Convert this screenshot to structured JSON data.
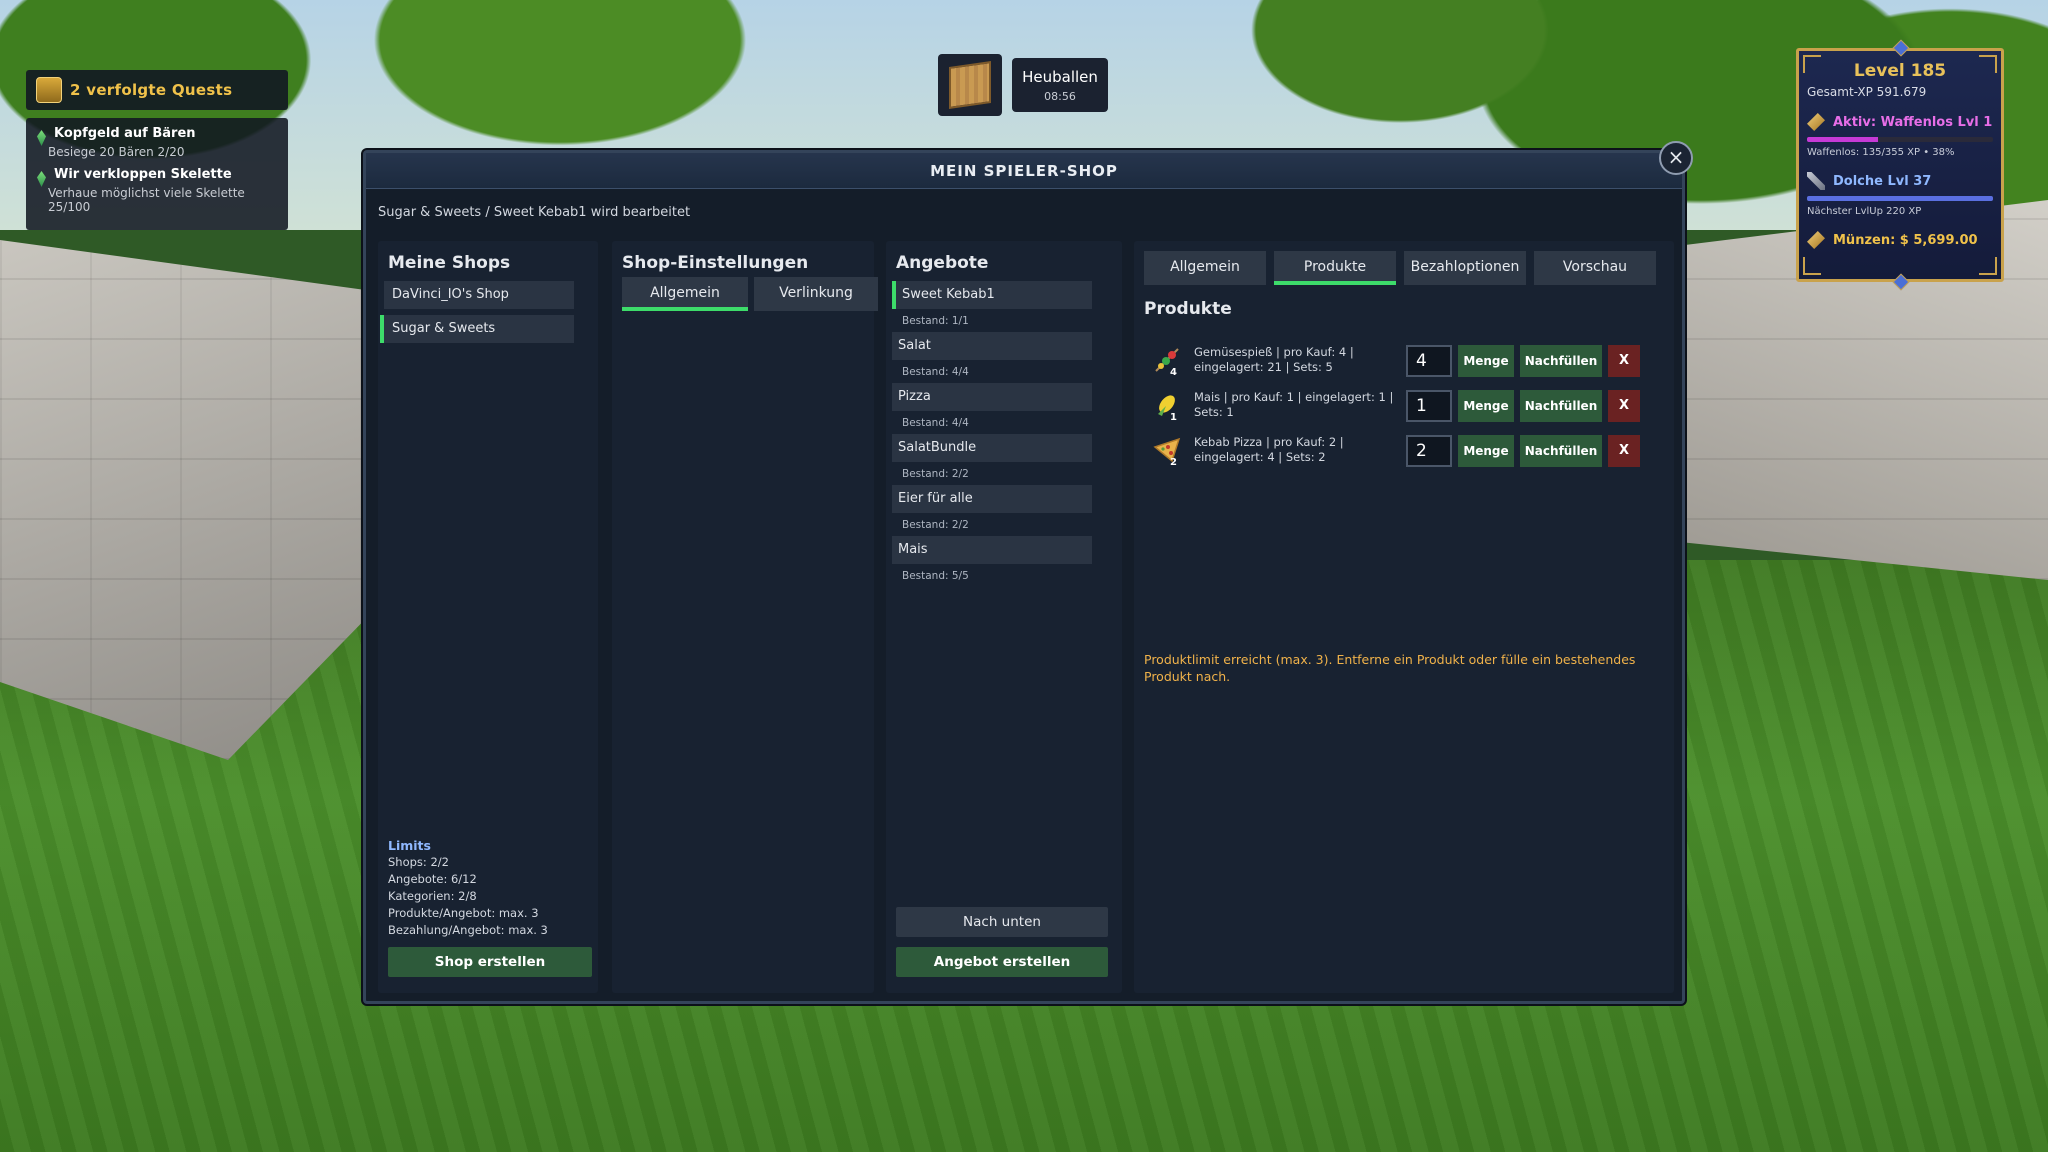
{
  "quests": {
    "header": "2 verfolgte Quests",
    "items": [
      {
        "title": "Kopfgeld auf Bären",
        "desc": "Besiege 20 Bären 2/20"
      },
      {
        "title": "Wir verkloppen Skelette",
        "desc": "Verhaue möglichst viele Skelette 25/100"
      }
    ]
  },
  "notification": {
    "title": "Heuballen",
    "time": "08:56"
  },
  "level_panel": {
    "title": "Level 185",
    "total_xp": "Gesamt-XP 591.679",
    "active": "Aktiv: Waffenlos Lvl 1",
    "active_progress": "Waffenlos: 135/355 XP • 38%",
    "active_fraction": 0.38,
    "dolche": "Dolche Lvl 37",
    "dolche_next": "Nächster LvlUp 220 XP",
    "dolche_fraction": 1.0,
    "coins": "Münzen: $ 5,699.00",
    "colors": {
      "frame": "#c9a24c",
      "active_bar": "#c63ad6",
      "dolche_bar": "#5a6fe0"
    }
  },
  "window": {
    "title": "MEIN SPIELER-SHOP",
    "breadcrumb": "Sugar & Sweets / Sweet Kebab1 wird bearbeitet",
    "close_icon": "×"
  },
  "my_shops": {
    "heading": "Meine Shops",
    "items": [
      "DaVinci_IO's Shop",
      "Sugar & Sweets"
    ],
    "limits_heading": "Limits",
    "limits": [
      "Shops: 2/2",
      "Angebote: 6/12",
      "Kategorien: 2/8",
      "Produkte/Angebot: max. 3",
      "Bezahlung/Angebot: max. 3"
    ],
    "create_button": "Shop erstellen"
  },
  "shop_settings": {
    "heading": "Shop-Einstellungen",
    "tabs": [
      "Allgemein",
      "Verlinkung"
    ]
  },
  "offers": {
    "heading": "Angebote",
    "items": [
      {
        "name": "Sweet Kebab1",
        "stock": "Bestand: 1/1"
      },
      {
        "name": "Salat",
        "stock": "Bestand: 4/4"
      },
      {
        "name": "Pizza",
        "stock": "Bestand: 4/4"
      },
      {
        "name": "SalatBundle",
        "stock": "Bestand: 2/2"
      },
      {
        "name": "Eier für alle",
        "stock": "Bestand: 2/2"
      },
      {
        "name": "Mais",
        "stock": "Bestand: 5/5"
      }
    ],
    "down_button": "Nach unten",
    "create_button": "Angebot erstellen"
  },
  "editor": {
    "tabs": [
      "Allgemein",
      "Produkte",
      "Bezahloptionen",
      "Vorschau"
    ],
    "section": "Produkte",
    "products": [
      {
        "text": "Gemüsespieß | pro Kauf: 4 | eingelagert: 21 | Sets: 5",
        "count": "4",
        "qty": "4",
        "icon": "skewer-icon"
      },
      {
        "text": "Mais | pro Kauf: 1 | eingelagert: 1 | Sets: 1",
        "count": "1",
        "qty": "1",
        "icon": "corn-icon"
      },
      {
        "text": "Kebab Pizza | pro Kauf: 2 | eingelagert: 4 | Sets: 2",
        "count": "2",
        "qty": "2",
        "icon": "pizza-icon"
      }
    ],
    "menge_label": "Menge",
    "refill_label": "Nachfüllen",
    "remove_label": "X",
    "warning": "Produktlimit erreicht (max. 3). Entferne ein Produkt oder fülle ein bestehendes Produkt nach."
  },
  "colors": {
    "accent": "#3ddc6a",
    "button": "#2d5a3a",
    "warning": "#f0b24a",
    "remove": "#6a2222"
  }
}
